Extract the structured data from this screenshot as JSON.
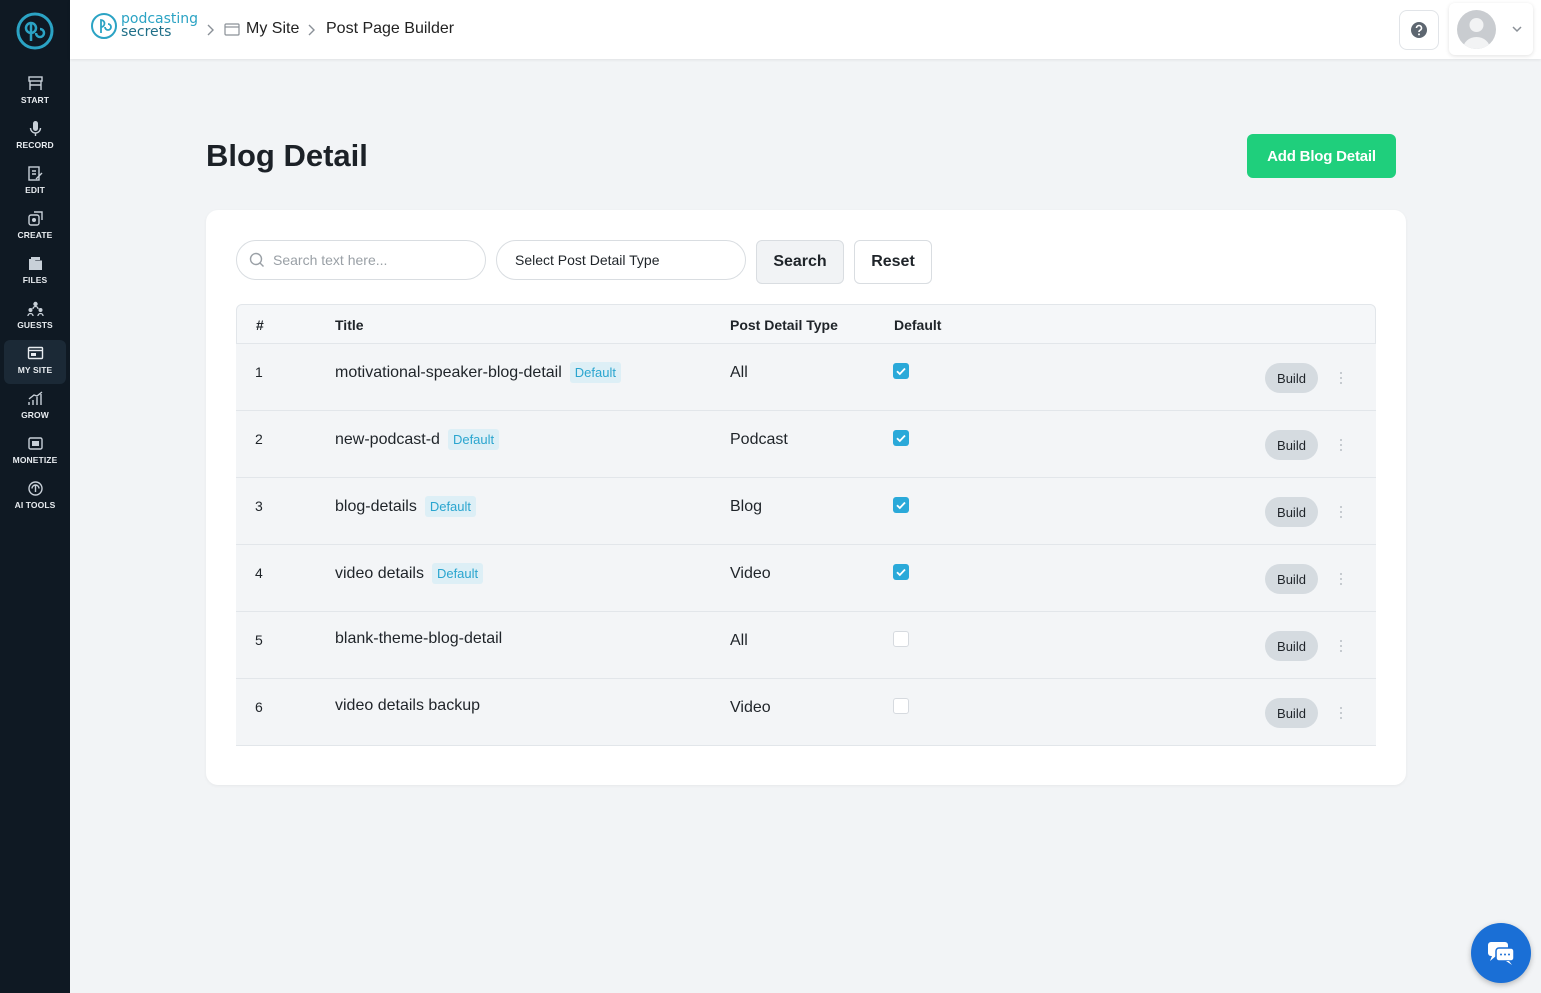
{
  "sidebar": {
    "items": [
      {
        "label": "START",
        "icon": "start-icon",
        "active": false
      },
      {
        "label": "RECORD",
        "icon": "microphone-icon",
        "active": false
      },
      {
        "label": "EDIT",
        "icon": "edit-icon",
        "active": false
      },
      {
        "label": "CREATE",
        "icon": "create-icon",
        "active": false
      },
      {
        "label": "FILES",
        "icon": "files-icon",
        "active": false
      },
      {
        "label": "GUESTS",
        "icon": "guests-icon",
        "active": false
      },
      {
        "label": "MY SITE",
        "icon": "site-icon",
        "active": true
      },
      {
        "label": "GROW",
        "icon": "grow-icon",
        "active": false
      },
      {
        "label": "MONETIZE",
        "icon": "monetize-icon",
        "active": false
      },
      {
        "label": "AI TOOLS",
        "icon": "ai-tools-icon",
        "active": false
      }
    ]
  },
  "header": {
    "brand_line1": "podcasting",
    "brand_line2": "secrets",
    "breadcrumb": [
      "My Site",
      "Post Page Builder"
    ]
  },
  "page": {
    "title": "Blog Detail",
    "add_button": "Add Blog Detail"
  },
  "filters": {
    "search_placeholder": "Search text here...",
    "select_label": "Select Post Detail Type",
    "search_button": "Search",
    "reset_button": "Reset"
  },
  "table": {
    "columns": [
      "#",
      "Title",
      "Post Detail Type",
      "Default"
    ],
    "default_badge": "Default",
    "build_label": "Build",
    "rows": [
      {
        "num": "1",
        "title": "motivational-speaker-blog-detail",
        "badge": true,
        "type": "All",
        "default": true
      },
      {
        "num": "2",
        "title": "new-podcast-d",
        "badge": true,
        "type": "Podcast",
        "default": true
      },
      {
        "num": "3",
        "title": "blog-details",
        "badge": true,
        "type": "Blog",
        "default": true
      },
      {
        "num": "4",
        "title": "video details",
        "badge": true,
        "type": "Video",
        "default": true
      },
      {
        "num": "5",
        "title": "blank-theme-blog-detail",
        "badge": false,
        "type": "All",
        "default": false
      },
      {
        "num": "6",
        "title": "video details backup",
        "badge": false,
        "type": "Video",
        "default": false
      }
    ]
  },
  "colors": {
    "sidebar_bg": "#0f1923",
    "accent_green": "#1fcf7c",
    "accent_blue": "#2aa9d9",
    "chat_blue": "#1a6fd6"
  }
}
